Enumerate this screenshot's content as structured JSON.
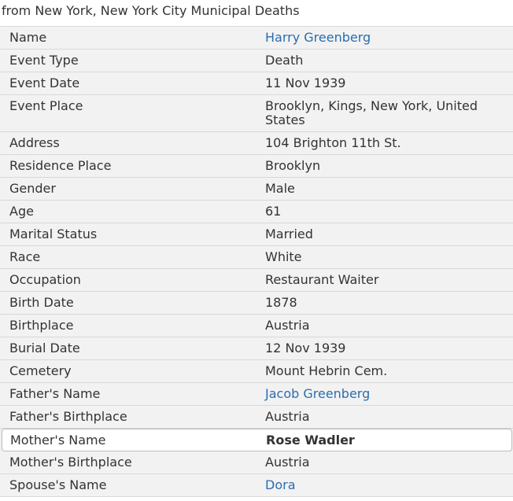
{
  "record_source": "from New York, New York City Municipal Deaths",
  "colors": {
    "link": "#2a6db0",
    "text": "#333333",
    "row_background": "#f2f2f2",
    "highlight_background": "#ffffff",
    "divider": "#d8d8d8"
  },
  "rows": [
    {
      "label": "Name",
      "value": "Harry Greenberg",
      "link": true
    },
    {
      "label": "Event Type",
      "value": "Death"
    },
    {
      "label": "Event Date",
      "value": "11 Nov 1939"
    },
    {
      "label": "Event Place",
      "value": "Brooklyn, Kings, New York, United States"
    },
    {
      "label": "Address",
      "value": "104 Brighton 11th St."
    },
    {
      "label": "Residence Place",
      "value": "Brooklyn"
    },
    {
      "label": "Gender",
      "value": "Male"
    },
    {
      "label": "Age",
      "value": "61"
    },
    {
      "label": "Marital Status",
      "value": "Married"
    },
    {
      "label": "Race",
      "value": "White"
    },
    {
      "label": "Occupation",
      "value": "Restaurant Waiter"
    },
    {
      "label": "Birth Date",
      "value": "1878"
    },
    {
      "label": "Birthplace",
      "value": "Austria"
    },
    {
      "label": "Burial Date",
      "value": "12 Nov 1939"
    },
    {
      "label": "Cemetery",
      "value": "Mount Hebrin Cem."
    },
    {
      "label": "Father's Name",
      "value": "Jacob Greenberg",
      "link": true
    },
    {
      "label": "Father's Birthplace",
      "value": "Austria"
    },
    {
      "label": "Mother's Name",
      "value": "Rose Wadler",
      "highlighted": true
    },
    {
      "label": "Mother's Birthplace",
      "value": "Austria"
    },
    {
      "label": "Spouse's Name",
      "value": "Dora",
      "link": true
    }
  ]
}
